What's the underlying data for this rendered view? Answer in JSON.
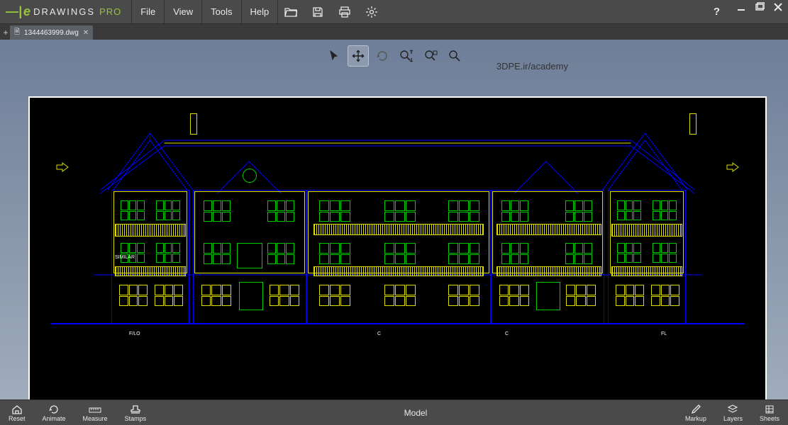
{
  "brand": {
    "prefix": "e",
    "name": "DRAWINGS",
    "suffix": "PRO"
  },
  "menu": {
    "items": [
      "File",
      "View",
      "Tools",
      "Help"
    ]
  },
  "tabs": {
    "active": {
      "filename": "1344463999.dwg"
    }
  },
  "watermark": "3DPE.ir/academy",
  "view_tools": [
    "select",
    "pan",
    "rotate",
    "zoom-window",
    "zoom-fit",
    "zoom"
  ],
  "status": {
    "mode": "Model"
  },
  "bottom_left": [
    {
      "id": "reset",
      "label": "Reset"
    },
    {
      "id": "animate",
      "label": "Animate"
    },
    {
      "id": "measure",
      "label": "Measure"
    },
    {
      "id": "stamps",
      "label": "Stamps"
    }
  ],
  "bottom_right": [
    {
      "id": "markup",
      "label": "Markup"
    },
    {
      "id": "layers",
      "label": "Layers"
    },
    {
      "id": "sheets",
      "label": "Sheets"
    }
  ],
  "drawing": {
    "axis_labels": {
      "left": "F/LO",
      "mid1": "C",
      "mid2": "C",
      "right": "FL"
    },
    "small_text": "SIMILAR"
  }
}
